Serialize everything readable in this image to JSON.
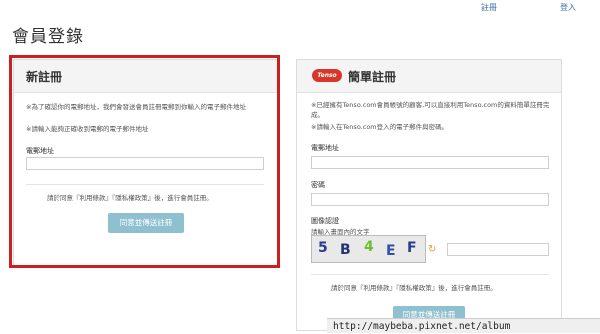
{
  "topnav": {
    "register": "註冊",
    "login": "登入"
  },
  "page_title": "會員登錄",
  "left_panel": {
    "title": "新註冊",
    "note1": "※為了確認你的電郵地址，我們會發送會員註冊電郵到你輸入的電子郵件地址",
    "note2": "※請輸入能夠正確收到電郵的電子郵件地址",
    "email_label": "電郵地址",
    "email_value": "",
    "agree_text": "請於同意『利用條款』『隱私權政策』後，進行會員註冊。",
    "submit_label": "同意並傳送註冊"
  },
  "right_panel": {
    "logo_text": "Tenso",
    "title": "簡單註冊",
    "note1": "※已經擁有Tenso.com會員帳號的顧客,可以直接利用Tenso.com的資料簡單註冊完成。",
    "note2": "※請輸入在Tenso.com登入的電子郵件與密碼。",
    "email_label": "電郵地址",
    "password_label": "密碼",
    "captcha_label": "圖像認證",
    "captcha_hint": "請輸入畫面內的文字",
    "captcha_chars": [
      "5",
      "B",
      "4",
      "E",
      "F"
    ],
    "agree_text": "請於同意『利用條款』『隱私權政策』後，進行會員註冊。",
    "submit_label": "同意並傳送註冊"
  },
  "watermark": "http://maybeba.pixnet.net/album",
  "colors": {
    "highlight": "#cc1f1f",
    "button": "#8fc0cf",
    "link": "#3a6fa8"
  }
}
